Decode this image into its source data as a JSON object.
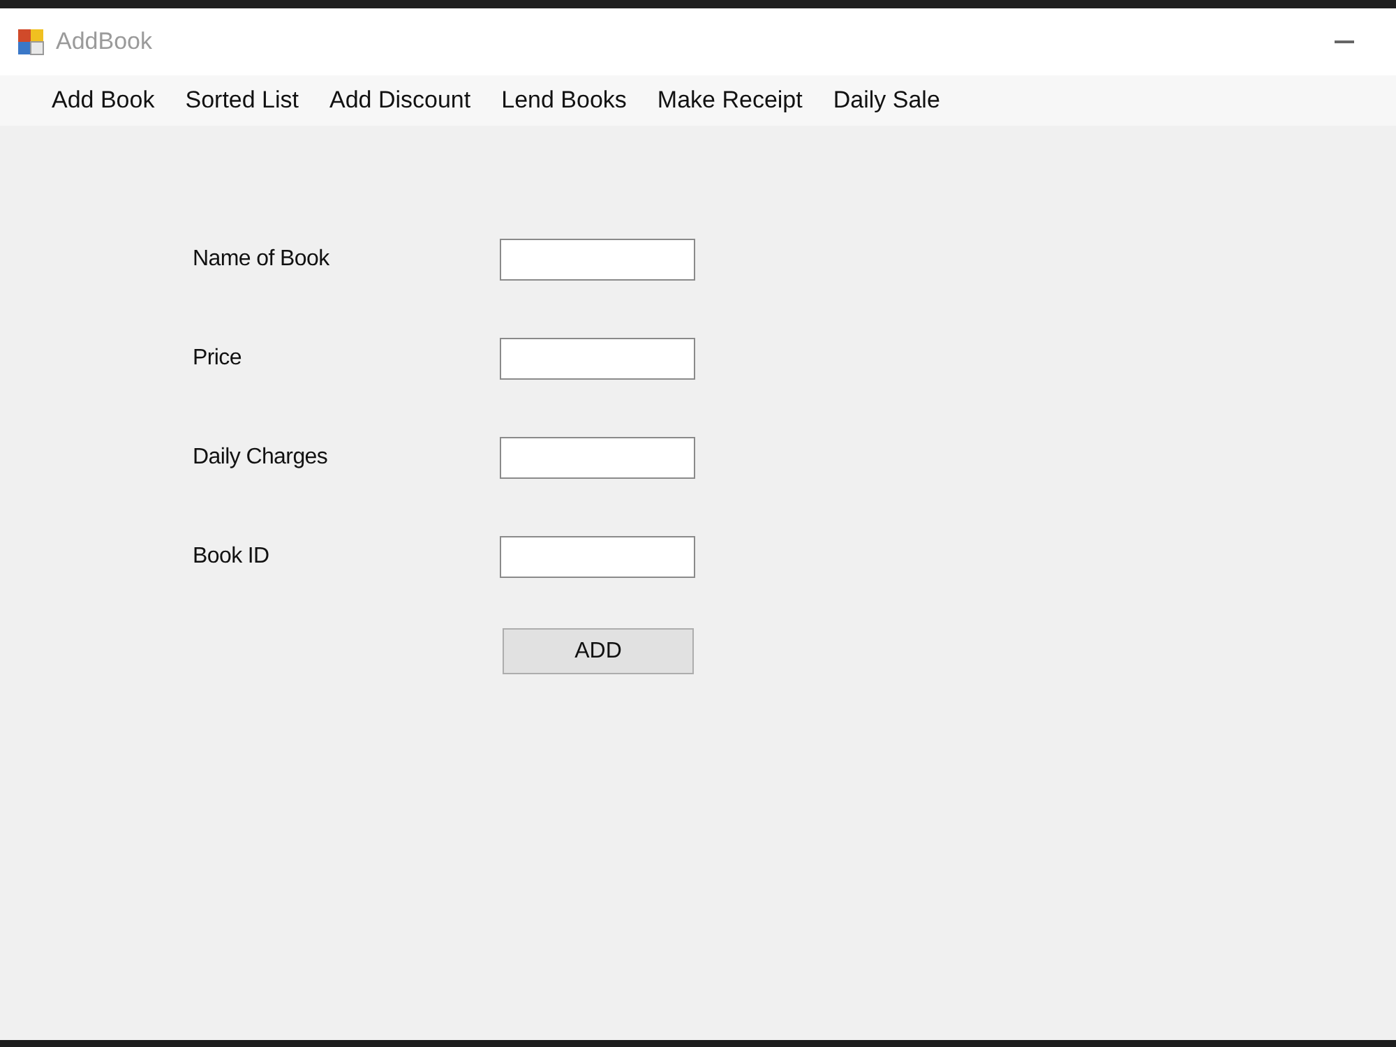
{
  "window": {
    "title": "AddBook"
  },
  "menu": [
    {
      "label": "Add Book"
    },
    {
      "label": "Sorted List"
    },
    {
      "label": "Add Discount"
    },
    {
      "label": "Lend Books"
    },
    {
      "label": "Make Receipt"
    },
    {
      "label": "Daily Sale"
    }
  ],
  "form": {
    "fields": [
      {
        "label": "Name of Book"
      },
      {
        "label": "Price"
      },
      {
        "label": "Daily Charges"
      },
      {
        "label": "Book ID"
      }
    ],
    "button": "ADD"
  }
}
